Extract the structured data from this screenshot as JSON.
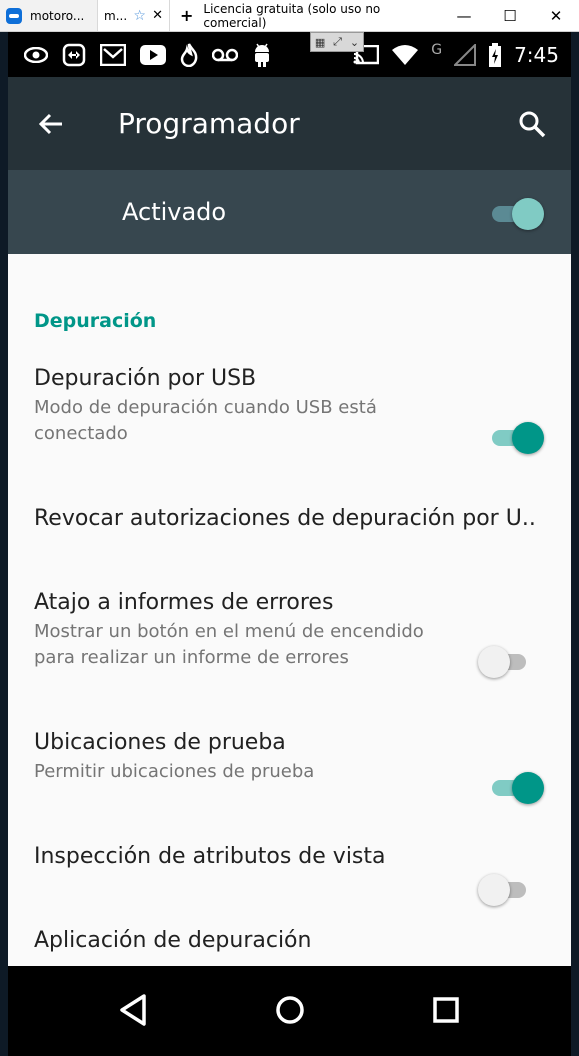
{
  "window": {
    "tab1": "motoro...",
    "tab2": "m...",
    "license": "Licencia gratuita (solo uso no comercial)",
    "minimize": "—",
    "maximize": "☐",
    "close": "✕"
  },
  "status_bar": {
    "time": "7:45",
    "network_letter": "G"
  },
  "app_bar": {
    "title": "Programador"
  },
  "master": {
    "label": "Activado",
    "on": true
  },
  "section": {
    "title": "Depuración"
  },
  "preferences": [
    {
      "title": "Depuración por USB",
      "subtitle": "Modo de depuración cuando USB está conectado",
      "on": true
    },
    {
      "title": "Revocar autorizaciones de depuración por U..",
      "subtitle": ""
    },
    {
      "title": "Atajo a informes de errores",
      "subtitle": "Mostrar un botón en el menú de encendido para realizar un informe de errores",
      "on": false
    },
    {
      "title": "Ubicaciones de prueba",
      "subtitle": "Permitir ubicaciones de prueba",
      "on": true
    },
    {
      "title": "Inspección de atributos de vista",
      "subtitle": "",
      "on": false
    },
    {
      "title": "Aplicación de depuración",
      "subtitle": ""
    }
  ],
  "colors": {
    "accent": "#009688",
    "app_bar": "#263238",
    "master_row": "#37474f"
  }
}
